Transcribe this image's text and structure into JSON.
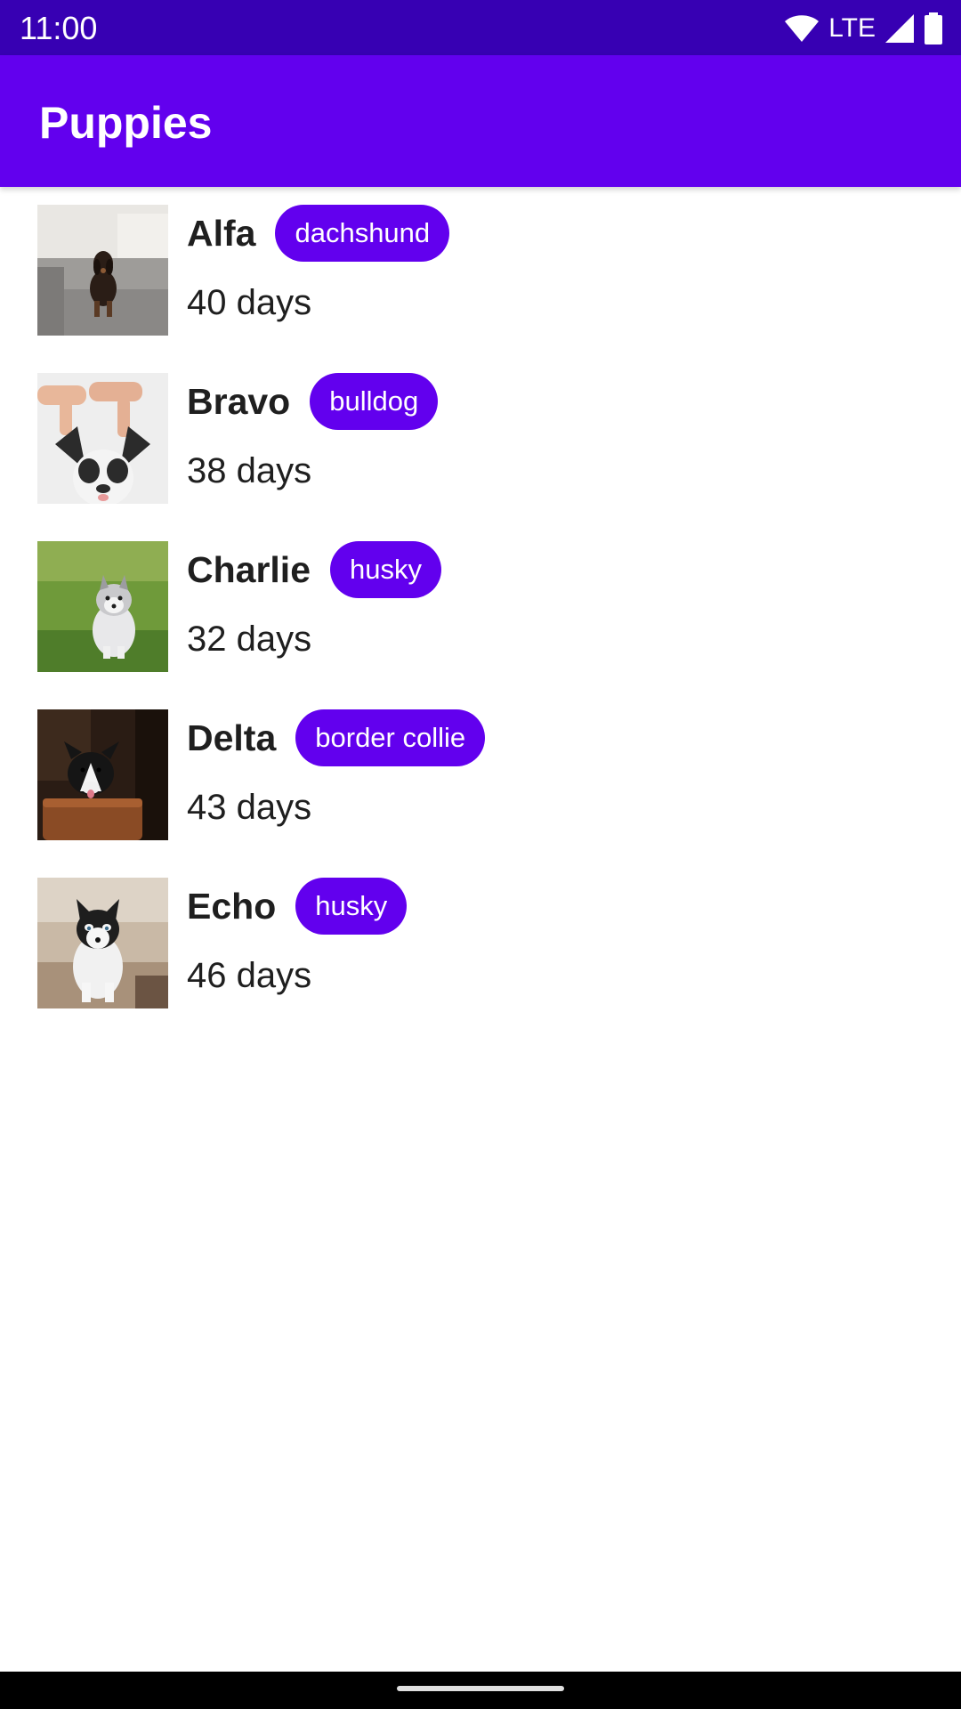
{
  "status_bar": {
    "time": "11:00",
    "network": "LTE",
    "icons": [
      "wifi-icon",
      "cell-signal-icon",
      "battery-icon"
    ]
  },
  "app_bar": {
    "title": "Puppies"
  },
  "puppies": [
    {
      "name": "Alfa",
      "breed": "dachshund",
      "age": "40 days",
      "photo": "dachshund-puppy-photo"
    },
    {
      "name": "Bravo",
      "breed": "bulldog",
      "age": "38 days",
      "photo": "bulldog-puppy-photo"
    },
    {
      "name": "Charlie",
      "breed": "husky",
      "age": "32 days",
      "photo": "husky-puppy-on-grass-photo"
    },
    {
      "name": "Delta",
      "breed": "border collie",
      "age": "43 days",
      "photo": "border-collie-puppy-in-bowl-photo"
    },
    {
      "name": "Echo",
      "breed": "husky",
      "age": "46 days",
      "photo": "husky-puppy-sitting-photo"
    }
  ],
  "colors": {
    "status_bar": "#3700b3",
    "app_bar": "#6200ee",
    "chip": "#6200ee",
    "text": "#1f1f1f"
  }
}
